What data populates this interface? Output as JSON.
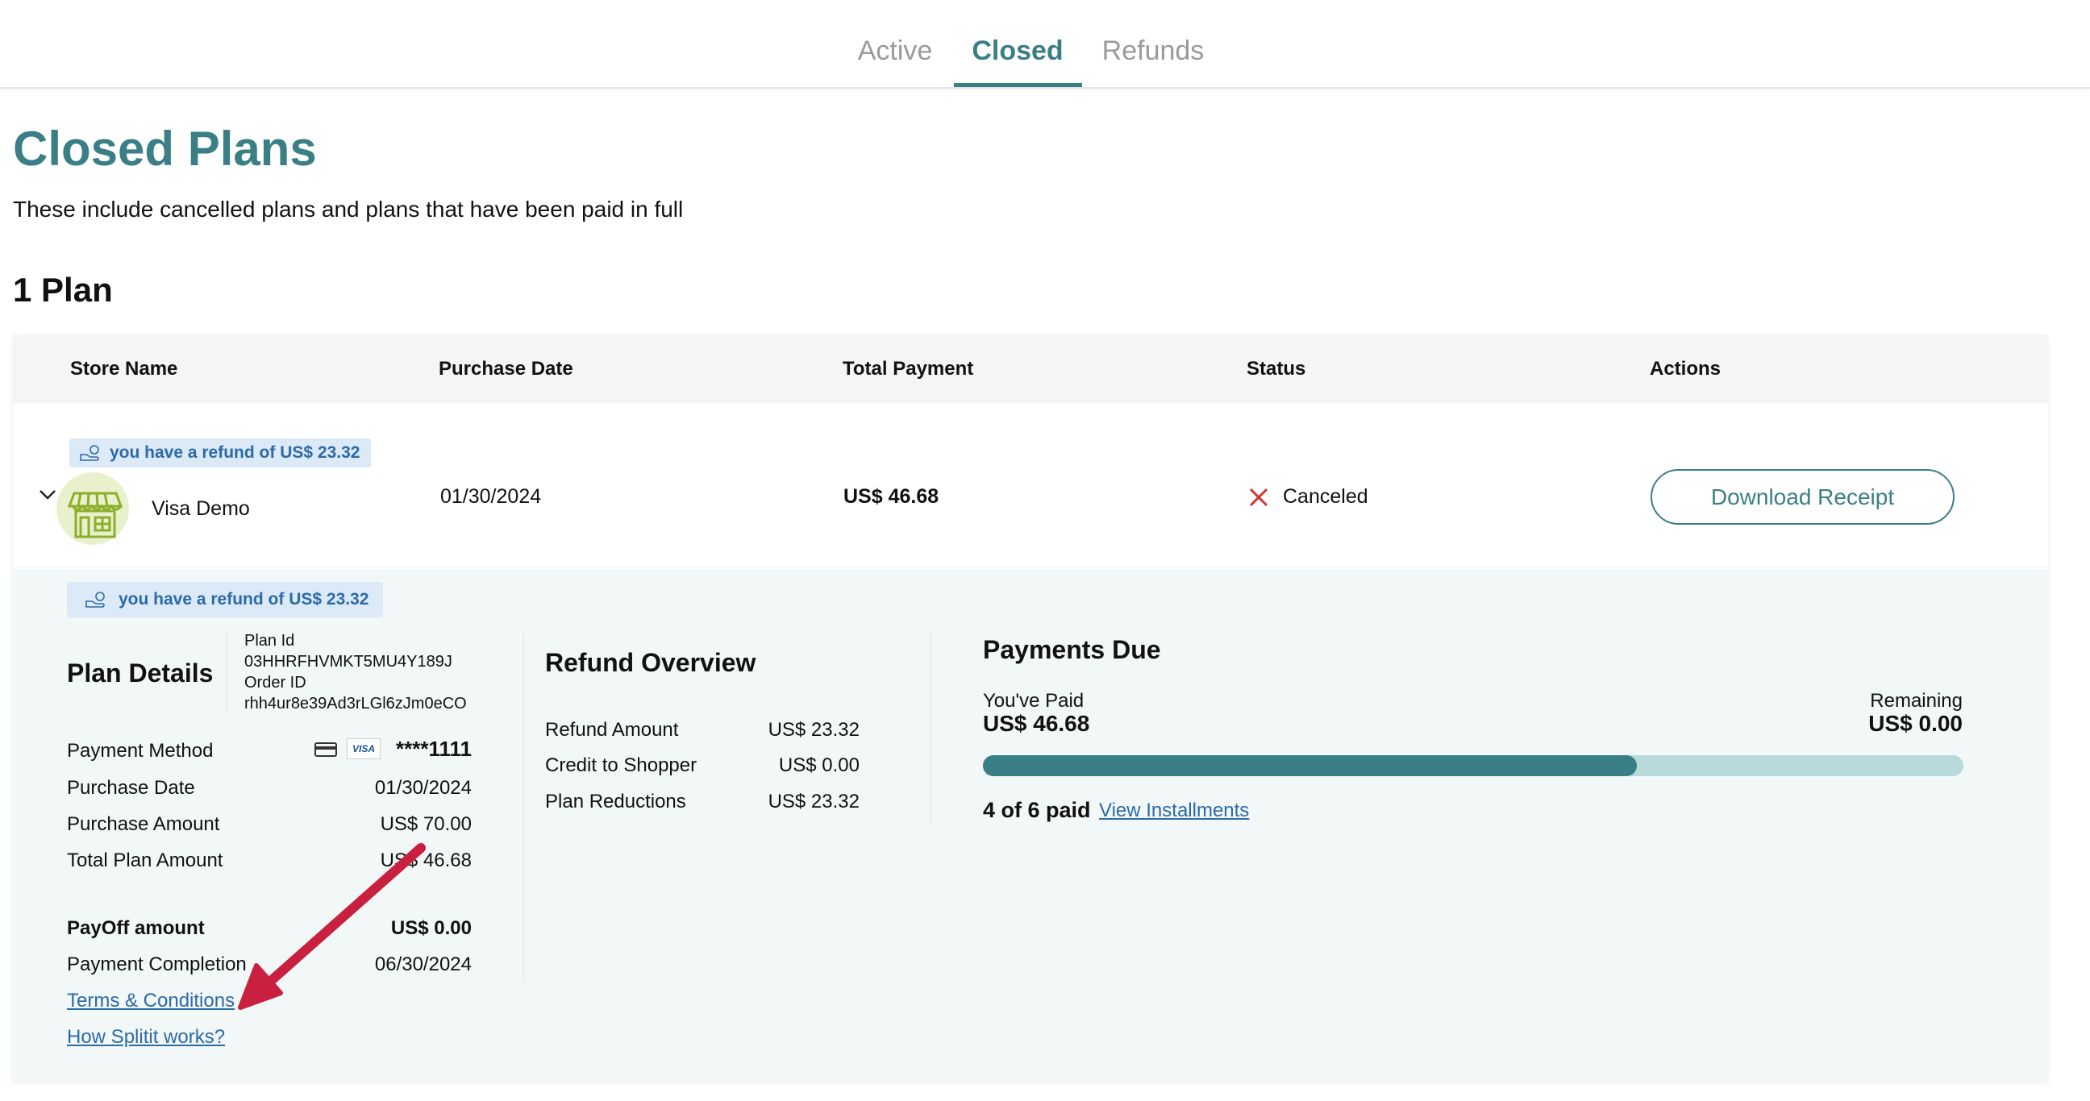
{
  "tabs": [
    {
      "label": "Active"
    },
    {
      "label": "Closed"
    },
    {
      "label": "Refunds"
    }
  ],
  "header": {
    "title": "Closed Plans",
    "subtitle": "These include cancelled plans and plans that have been paid in full",
    "plan_count": "1 Plan"
  },
  "table": {
    "columns": [
      "Store Name",
      "Purchase Date",
      "Total Payment",
      "Status",
      "Actions"
    ],
    "row": {
      "refund_badge": "you have a refund of US$ 23.32",
      "store_name": "Visa Demo",
      "purchase_date": "01/30/2024",
      "total_payment": "US$ 46.68",
      "status": "Canceled",
      "action_label": "Download Receipt"
    }
  },
  "details": {
    "refund_badge": "you have a refund of US$ 23.32",
    "plan_details": {
      "title": "Plan Details",
      "plan_id_label": "Plan Id",
      "plan_id": "03HHRFHVMKT5MU4Y189J",
      "order_id_label": "Order ID",
      "order_id": "rhh4ur8e39Ad3rLGl6zJm0eCO",
      "rows": [
        {
          "label": "Payment Method",
          "value": "****1111"
        },
        {
          "label": "Purchase Date",
          "value": "01/30/2024"
        },
        {
          "label": "Purchase Amount",
          "value": "US$ 70.00"
        },
        {
          "label": "Total Plan Amount",
          "value": "US$ 46.68"
        }
      ],
      "payoff_label": "PayOff amount",
      "payoff_value": "US$ 0.00",
      "completion_label": "Payment Completion",
      "completion_value": "06/30/2024",
      "terms_link": "Terms & Conditions",
      "how_link": "How Splitit works?",
      "card_brand": "VISA"
    },
    "refund_overview": {
      "title": "Refund Overview",
      "rows": [
        {
          "label": "Refund Amount",
          "value": "US$ 23.32"
        },
        {
          "label": "Credit to Shopper",
          "value": "US$ 0.00"
        },
        {
          "label": "Plan Reductions",
          "value": "US$ 23.32"
        }
      ]
    },
    "payments_due": {
      "title": "Payments Due",
      "paid_label": "You've Paid",
      "paid_value": "US$ 46.68",
      "remaining_label": "Remaining",
      "remaining_value": "US$ 0.00",
      "progress_fraction": 0.667,
      "installments_text": "4 of 6 paid",
      "installments_link": "View Installments"
    }
  },
  "colors": {
    "accent": "#3a7f85",
    "link": "#2c6aa8",
    "badge_bg": "#dce9f6",
    "cancel_x": "#d0342c",
    "arrow": "#c8203e"
  }
}
